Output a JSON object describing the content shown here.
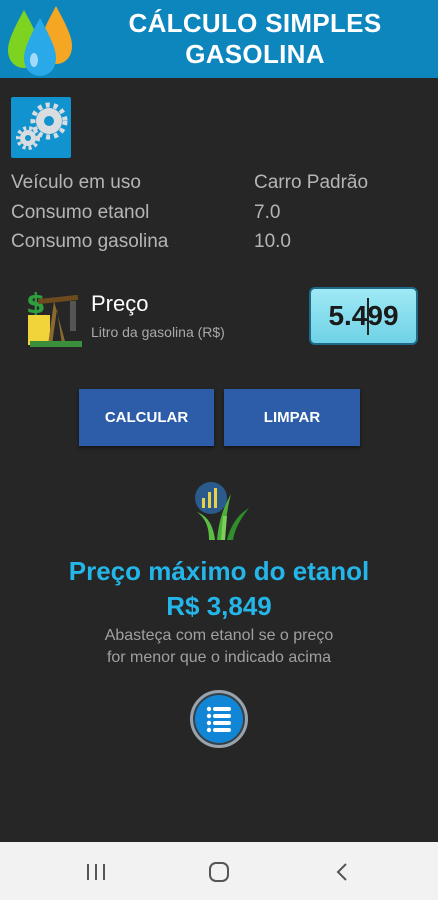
{
  "header": {
    "title_line1": "CÁLCULO SIMPLES",
    "title_line2": "GASOLINA",
    "logo_icon": "fuel-drops-icon"
  },
  "settings": {
    "icon": "gears-icon"
  },
  "vehicle_info": [
    {
      "label": "Veículo em uso",
      "value": "Carro Padrão"
    },
    {
      "label": "Consumo etanol",
      "value": "7.0"
    },
    {
      "label": "Consumo gasolina",
      "value": "10.0"
    }
  ],
  "price": {
    "icon": "oil-pump-money-icon",
    "title": "Preço",
    "subtitle": "Litro da gasolina (R$)",
    "input_value": "5.499"
  },
  "buttons": {
    "calculate": "CALCULAR",
    "clear": "LIMPAR"
  },
  "result": {
    "icon": "sugarcane-chart-icon",
    "title": "Preço máximo do etanol",
    "value": "R$ 3,849",
    "hint_line1": "Abasteça com etanol se o preço",
    "hint_line2": "for menor que o indicado acima"
  },
  "fab": {
    "icon": "list-icon"
  },
  "navbar": {
    "icons": [
      "recents-icon",
      "home-icon",
      "back-icon"
    ]
  },
  "colors": {
    "header_bg": "#0d86bd",
    "accent": "#25b6e9",
    "button_bg": "#2d5da8",
    "background": "#262626",
    "input_bg": "#8ee0ef"
  }
}
